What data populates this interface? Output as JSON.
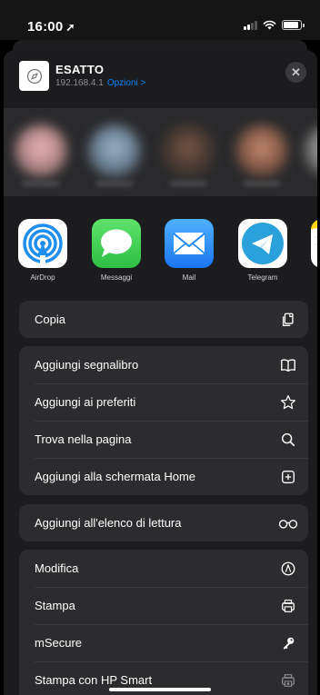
{
  "status": {
    "time": "16:00"
  },
  "site": {
    "title": "ESATTO",
    "address": "192.168.4.1",
    "options_label": "Opzioni >"
  },
  "apps": [
    {
      "label": "AirDrop",
      "icon": "airdrop-icon",
      "color": "#1f8ef1"
    },
    {
      "label": "Messaggi",
      "icon": "messages-icon",
      "color": "#34c759"
    },
    {
      "label": "Mail",
      "icon": "mail-icon",
      "color": "#1e88f6"
    },
    {
      "label": "Telegram",
      "icon": "telegram-icon",
      "color": "#2aa1da"
    },
    {
      "label": "",
      "icon": "notes-icon",
      "color": "#ffd60a"
    }
  ],
  "actions": {
    "copy": "Copia",
    "add_bookmark": "Aggiungi segnalibro",
    "add_favorites": "Aggiungi ai preferiti",
    "find_in_page": "Trova nella pagina",
    "add_home": "Aggiungi alla schermata Home",
    "reading_list": "Aggiungi all'elenco di lettura",
    "markup": "Modifica",
    "print": "Stampa",
    "msecure": "mSecure",
    "hp_print": "Stampa con HP Smart"
  }
}
